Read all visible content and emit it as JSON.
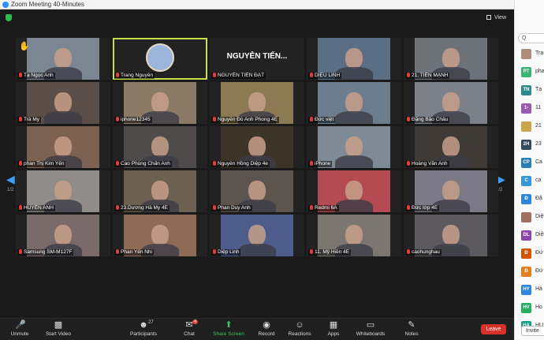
{
  "window": {
    "title": "Zoom Meeting 40-Minutes"
  },
  "topbar": {
    "view_label": "View"
  },
  "pager": {
    "page": "1/2"
  },
  "tiles": [
    {
      "name": "Tạ Ngọc Anh",
      "hand": true,
      "color": "#7a8793"
    },
    {
      "name": "Trang Nguyễn",
      "active": true,
      "avatar": true
    },
    {
      "name": "NGUYỄN TIẾN ĐẠT",
      "big": "NGUYỄN TIẾN..."
    },
    {
      "name": "DIỆU LINH",
      "color": "#5a6f84"
    },
    {
      "name": "21. TIẾN MẠNH",
      "color": "#6d7278"
    },
    {
      "name": "Trà My",
      "color": "#5b4d47"
    },
    {
      "name": "iphone12345",
      "color": "#8a7a66"
    },
    {
      "name": "Nguyễn Đỗ Anh Phong 4E",
      "color": "#8c7a55"
    },
    {
      "name": "Đức việt",
      "color": "#6c7e8e"
    },
    {
      "name": "Đặng Bảo Châu",
      "color": "#7c8088"
    },
    {
      "name": "phan Thị Kim Yến",
      "color": "#7d6252"
    },
    {
      "name": "Cao Phùng Chấn Anh",
      "color": "#4e4b4a"
    },
    {
      "name": "Nguyễn Hồng Diệp 4e",
      "color": "#3d3428"
    },
    {
      "name": "iPhone",
      "color": "#7e8a96"
    },
    {
      "name": "Hoàng Văn Anh",
      "color": "#3f3a36"
    },
    {
      "name": "HUYỀN ANH",
      "color": "#8f8c8a"
    },
    {
      "name": "23.Dương Hà My 4E",
      "color": "#6c6053"
    },
    {
      "name": "Phan Duy Anh",
      "color": "#5c544f"
    },
    {
      "name": "Redmi 6A",
      "color": "#b54b52"
    },
    {
      "name": "Đức lớp 4E",
      "color": "#7c7a86"
    },
    {
      "name": "Samsung SM-M127F",
      "color": "#7b6a6a"
    },
    {
      "name": "Phan Yến Nhi",
      "color": "#8e6b56"
    },
    {
      "name": "Diệp Linh",
      "color": "#4d5c8a"
    },
    {
      "name": "11. Mỹ Hiền 4E",
      "color": "#7b7770"
    },
    {
      "name": "caohunghau",
      "color": "#5c5a5e"
    }
  ],
  "toolbar": {
    "unmute": "Unmute",
    "start_video": "Start Video",
    "participants": "Participants",
    "participants_count": "27",
    "chat": "Chat",
    "chat_badge": "4",
    "share_screen": "Share Screen",
    "record": "Record",
    "reactions": "Reactions",
    "apps": "Apps",
    "whiteboards": "Whiteboards",
    "notes": "Notes",
    "leave": "Leave"
  },
  "sidepanel": {
    "search_placeholder": "Q",
    "items": [
      {
        "initials": "",
        "name": "Tra",
        "color": "#b08c7a"
      },
      {
        "initials": "PT",
        "name": "pha",
        "color": "#3cb371"
      },
      {
        "initials": "TN",
        "name": "Tạ",
        "color": "#2e8b8b"
      },
      {
        "initials": "1-",
        "name": "11",
        "color": "#9b59b6"
      },
      {
        "initials": "",
        "name": "21",
        "color": "#c9a64a"
      },
      {
        "initials": "2H",
        "name": "23",
        "color": "#34495e"
      },
      {
        "initials": "CP",
        "name": "Ca",
        "color": "#2980b9"
      },
      {
        "initials": "C",
        "name": "ca",
        "color": "#3498db"
      },
      {
        "initials": "Đ",
        "name": "Đặ",
        "color": "#2e86de"
      },
      {
        "initials": "",
        "name": "Diệ",
        "color": "#a07060"
      },
      {
        "initials": "DL",
        "name": "Diệ",
        "color": "#8e44ad"
      },
      {
        "initials": "Đ",
        "name": "Đứ",
        "color": "#d35400"
      },
      {
        "initials": "Đ",
        "name": "Đứ",
        "color": "#e67e22"
      },
      {
        "initials": "HY",
        "name": "Hả",
        "color": "#2e86de"
      },
      {
        "initials": "HV",
        "name": "Ho",
        "color": "#27ae60"
      },
      {
        "initials": "HA",
        "name": "HU",
        "color": "#16a085"
      }
    ],
    "invite": "Invite"
  }
}
